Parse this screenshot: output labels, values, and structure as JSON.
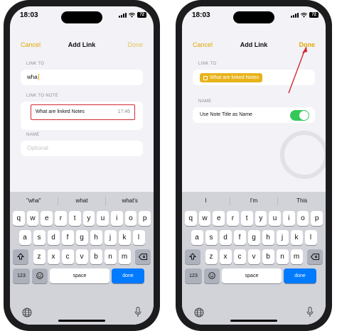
{
  "left": {
    "status": {
      "time": "18:03",
      "battery": "72"
    },
    "nav": {
      "cancel": "Cancel",
      "title": "Add Link",
      "done": "Done"
    },
    "link_to_label": "LINK TO",
    "link_to_value": "wha",
    "link_to_note_label": "LINK TO NOTE",
    "note_suggestion": {
      "name": "What are linked Notes",
      "time": "17:46"
    },
    "name_label": "NAME",
    "name_placeholder": "Optional",
    "suggestions": [
      "\"wha\"",
      "what",
      "what's"
    ]
  },
  "right": {
    "status": {
      "time": "18:03",
      "battery": "72"
    },
    "nav": {
      "cancel": "Cancel",
      "title": "Add Link",
      "done": "Done"
    },
    "link_to_label": "LINK TO",
    "link_chip": "What are linked Notes",
    "name_label": "NAME",
    "toggle_label": "Use Note Title as Name",
    "toggle_on": true,
    "suggestions": [
      "I",
      "I'm",
      "This"
    ]
  },
  "keyboard": {
    "row1": [
      "q",
      "w",
      "e",
      "r",
      "t",
      "y",
      "u",
      "i",
      "o",
      "p"
    ],
    "row2": [
      "a",
      "s",
      "d",
      "f",
      "g",
      "h",
      "j",
      "k",
      "l"
    ],
    "row3": [
      "z",
      "x",
      "c",
      "v",
      "b",
      "n",
      "m"
    ],
    "numbers": "123",
    "space": "space",
    "done": "done"
  },
  "colors": {
    "accent": "#e4a900",
    "highlight_box": "#d12b36",
    "toggle": "#34c759",
    "done_key": "#007aff"
  },
  "icons": [
    "wifi-icon",
    "signal-icon",
    "battery-icon",
    "shift-icon",
    "delete-icon",
    "emoji-icon",
    "globe-icon",
    "mic-icon",
    "note-icon",
    "arrow-annotation"
  ]
}
